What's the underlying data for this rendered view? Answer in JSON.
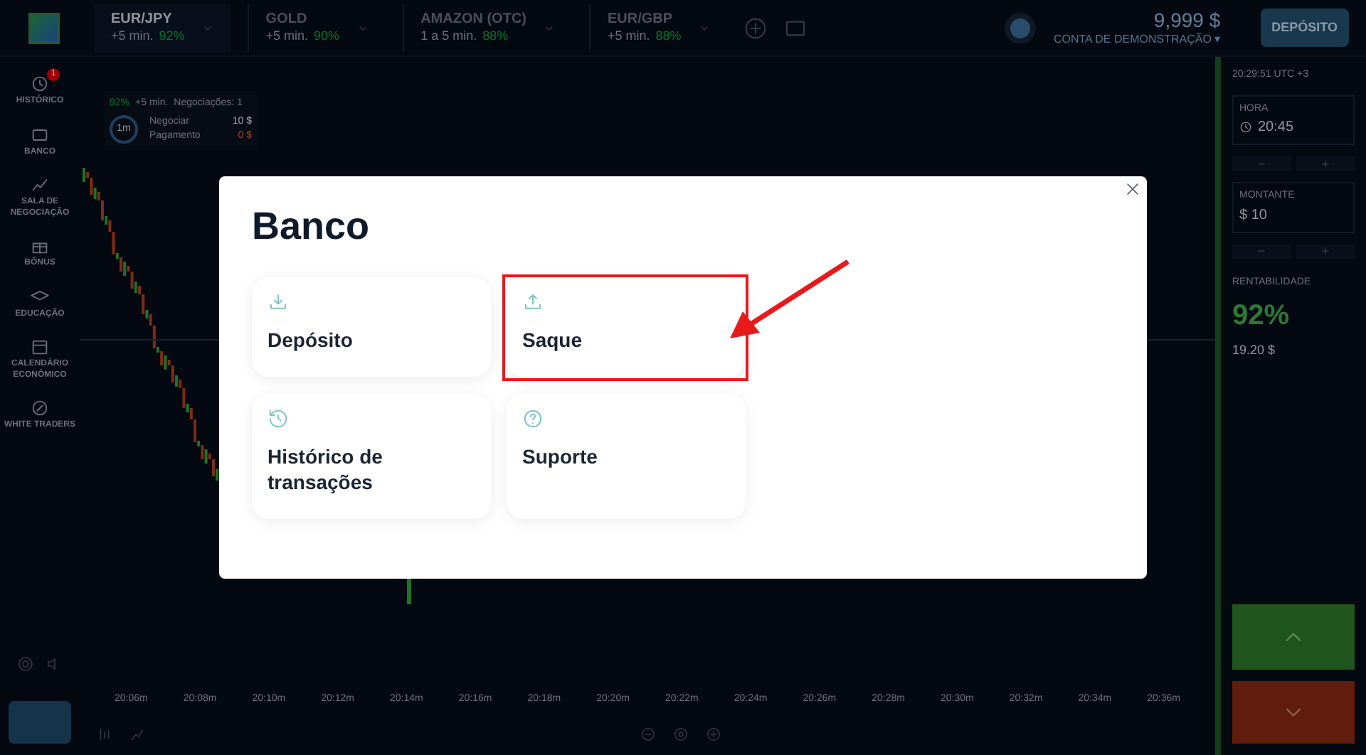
{
  "top_bar": {
    "assets": [
      {
        "name": "EUR/JPY",
        "period": "+5 min.",
        "payout": "92%",
        "selected": true
      },
      {
        "name": "GOLD",
        "period": "+5 min.",
        "payout": "90%",
        "selected": false
      },
      {
        "name": "AMAZON (OTC)",
        "period": "1 a 5 min.",
        "payout": "88%",
        "selected": false
      },
      {
        "name": "EUR/GBP",
        "period": "+5 min.",
        "payout": "88%",
        "selected": false
      }
    ],
    "balance": "9,999 $",
    "account": "CONTA DE DEMONSTRAÇÃO ▾",
    "deposit_button": "DEPÓSITO"
  },
  "sidebar": {
    "items": [
      {
        "label": "HISTÓRICO",
        "kind": "history",
        "badge": "1"
      },
      {
        "label": "BANCO",
        "kind": "bank"
      },
      {
        "label": "SALA DE NEGOCIAÇÃO",
        "kind": "room"
      },
      {
        "label": "BÔNUS",
        "kind": "gift"
      },
      {
        "label": "EDUCAÇÃO",
        "kind": "education"
      },
      {
        "label": "CALENDÁRIO ECONÔMICO",
        "kind": "calendar"
      },
      {
        "label": "WHITE TRADERS",
        "kind": "people"
      }
    ]
  },
  "trade_info": {
    "payout": "92%",
    "period": "+5 min.",
    "trades": "Negociações: 1",
    "timer": "1m",
    "rows": [
      {
        "label": "Negociar",
        "value": "10 $"
      },
      {
        "label": "Pagamento",
        "value": "0 $"
      }
    ]
  },
  "time_axis": [
    "20:06m",
    "20:08m",
    "20:10m",
    "20:12m",
    "20:14m",
    "20:16m",
    "20:18m",
    "20:20m",
    "20:22m",
    "20:24m",
    "20:26m",
    "20:28m",
    "20:30m",
    "20:32m",
    "20:34m",
    "20:36m"
  ],
  "right_panel": {
    "clock": "20:29:51 UTC +3",
    "time_field": {
      "label": "HORA",
      "value": "20:45"
    },
    "amount_field": {
      "label": "MONTANTE",
      "value": "$ 10"
    },
    "profit_label": "RENTABILIDADE",
    "profit": "92%",
    "profit_amount": "19.20 $"
  },
  "modal": {
    "title": "Banco",
    "cards": [
      {
        "label": "Depósito",
        "kind": "download",
        "highlighted": false
      },
      {
        "label": "Saque",
        "kind": "upload",
        "highlighted": true
      },
      {
        "label": "Histórico de transações",
        "kind": "history",
        "highlighted": false
      },
      {
        "label": "Suporte",
        "kind": "help",
        "highlighted": false
      }
    ]
  }
}
